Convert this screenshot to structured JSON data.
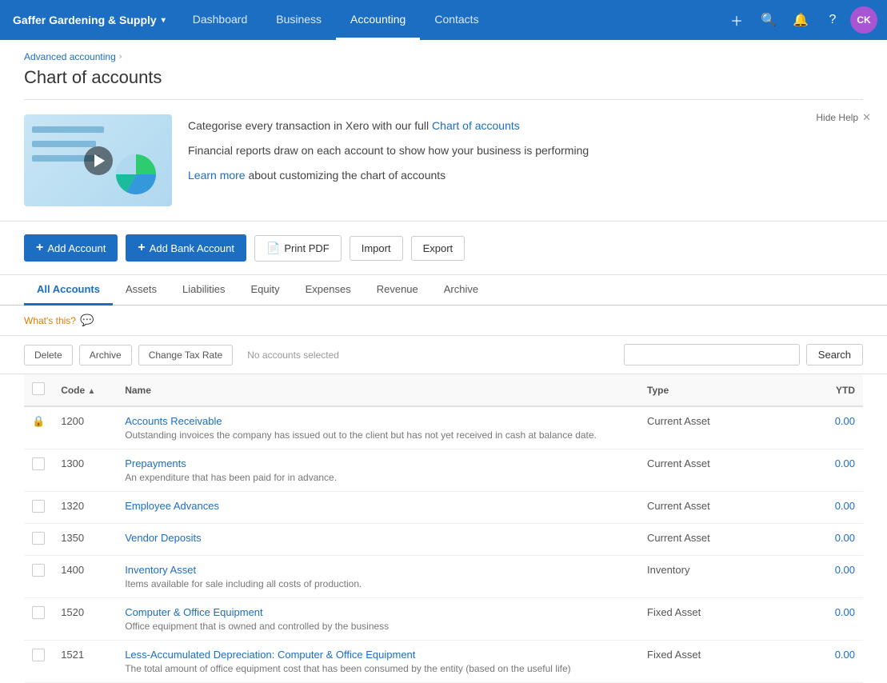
{
  "app": {
    "brand": "Gaffer Gardening & Supply",
    "nav_items": [
      "Dashboard",
      "Business",
      "Accounting",
      "Contacts"
    ],
    "active_nav": "Accounting",
    "user_initials": "CK"
  },
  "breadcrumb": {
    "parent": "Advanced accounting",
    "current": "Chart of accounts"
  },
  "page_title": "Chart of accounts",
  "help_banner": {
    "hide_label": "Hide Help",
    "line1_pre": "Categorise every transaction in Xero with our full",
    "line1_link": "Chart of accounts",
    "line2": "Financial reports draw on each account to show how your business is performing",
    "line3_pre": "Learn more",
    "line3_post": "about customizing the chart of accounts"
  },
  "action_bar": {
    "add_account": "Add Account",
    "add_bank_account": "Add Bank Account",
    "print_pdf": "Print PDF",
    "import": "Import",
    "export": "Export"
  },
  "tabs": [
    "All Accounts",
    "Assets",
    "Liabilities",
    "Equity",
    "Expenses",
    "Revenue",
    "Archive"
  ],
  "active_tab": "All Accounts",
  "whats_this": "What's this?",
  "table_controls": {
    "delete": "Delete",
    "archive": "Archive",
    "change_tax_rate": "Change Tax Rate",
    "no_selected": "No accounts selected",
    "search_placeholder": "",
    "search_btn": "Search"
  },
  "table_headers": {
    "code": "Code",
    "name": "Name",
    "type": "Type",
    "ytd": "YTD"
  },
  "accounts": [
    {
      "code": "1200",
      "name": "Accounts Receivable",
      "description": "Outstanding invoices the company has issued out to the client but has not yet received in cash at balance date.",
      "type": "Current Asset",
      "ytd": "0.00",
      "locked": true
    },
    {
      "code": "1300",
      "name": "Prepayments",
      "description": "An expenditure that has been paid for in advance.",
      "type": "Current Asset",
      "ytd": "0.00",
      "locked": false
    },
    {
      "code": "1320",
      "name": "Employee Advances",
      "description": "",
      "type": "Current Asset",
      "ytd": "0.00",
      "locked": false
    },
    {
      "code": "1350",
      "name": "Vendor Deposits",
      "description": "",
      "type": "Current Asset",
      "ytd": "0.00",
      "locked": false
    },
    {
      "code": "1400",
      "name": "Inventory Asset",
      "description": "Items available for sale including all costs of production.",
      "type": "Inventory",
      "ytd": "0.00",
      "locked": false
    },
    {
      "code": "1520",
      "name": "Computer & Office Equipment",
      "description": "Office equipment that is owned and controlled by the business",
      "type": "Fixed Asset",
      "ytd": "0.00",
      "locked": false
    },
    {
      "code": "1521",
      "name": "Less-Accumulated Depreciation: Computer & Office Equipment",
      "description": "The total amount of office equipment cost that has been consumed by the entity (based on the useful life)",
      "type": "Fixed Asset",
      "ytd": "0.00",
      "locked": false
    }
  ]
}
